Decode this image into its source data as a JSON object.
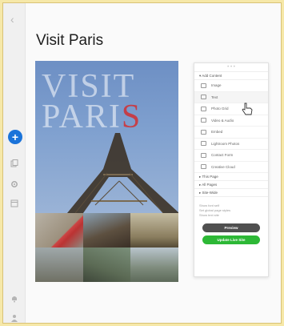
{
  "page": {
    "title": "Visit Paris"
  },
  "hero": {
    "line1": "VISIT",
    "line2_a": "PARI",
    "line2_b": "S"
  },
  "panel": {
    "section_add": "Add Content",
    "items": [
      {
        "label": "Image",
        "icon": "image-icon"
      },
      {
        "label": "Text",
        "icon": "text-icon"
      },
      {
        "label": "Photo Grid",
        "icon": "photo-grid-icon"
      },
      {
        "label": "Video & Audio",
        "icon": "video-icon"
      },
      {
        "label": "Embed",
        "icon": "embed-icon"
      },
      {
        "label": "Lightroom Photos",
        "icon": "lightroom-icon"
      },
      {
        "label": "Contact Form",
        "icon": "contact-form-icon"
      },
      {
        "label": "Creative Cloud",
        "icon": "creative-cloud-icon"
      }
    ],
    "section_this_page": "This Page",
    "section_all_pages": "All Pages",
    "section_site_wide": "Site-Wide",
    "links": [
      "Show font self",
      "Set global page styles",
      "Show text site"
    ],
    "preview": "Preview",
    "update": "Update Live Site"
  },
  "sidebar": {
    "icons": [
      "plus-icon",
      "pages-icon",
      "settings-icon",
      "layout-icon",
      "notification-icon",
      "user-icon"
    ]
  },
  "colors": {
    "accent": "#1a73d9",
    "update": "#2db836",
    "preview": "#505050"
  }
}
